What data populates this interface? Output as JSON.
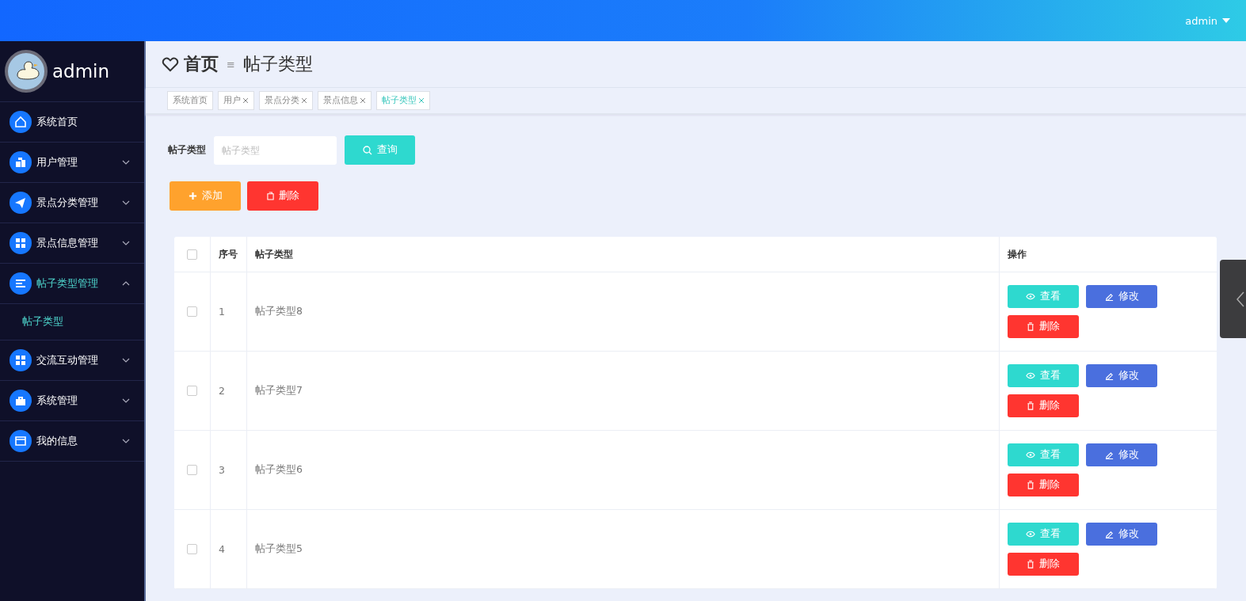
{
  "top_bar": {
    "user": "admin"
  },
  "sidebar": {
    "user_name": "admin",
    "items": [
      {
        "label": "系统首页",
        "selected": false
      },
      {
        "label": "用户管理",
        "selected": false,
        "expanded": false
      },
      {
        "label": "景点分类管理",
        "selected": false,
        "expanded": false
      },
      {
        "label": "景点信息管理",
        "selected": false,
        "expanded": false
      },
      {
        "label": "帖子类型管理",
        "selected": true,
        "expanded": true,
        "children": [
          {
            "label": "帖子类型",
            "selected": true
          }
        ]
      },
      {
        "label": "交流互动管理",
        "selected": false,
        "expanded": false
      },
      {
        "label": "系统管理",
        "selected": false,
        "expanded": false
      },
      {
        "label": "我的信息",
        "selected": false,
        "expanded": false
      }
    ]
  },
  "breadcrumb": {
    "home": "首页",
    "separator": "≡",
    "current": "帖子类型"
  },
  "tags": [
    {
      "label": "系统首页",
      "closable": false,
      "selected": false
    },
    {
      "label": "用户",
      "closable": true,
      "selected": false
    },
    {
      "label": "景点分类",
      "closable": true,
      "selected": false
    },
    {
      "label": "景点信息",
      "closable": true,
      "selected": false
    },
    {
      "label": "帖子类型",
      "closable": true,
      "selected": true
    }
  ],
  "search": {
    "label": "帖子类型",
    "placeholder": "帖子类型",
    "button": "查询"
  },
  "actions": {
    "add": "添加",
    "delete": "删除"
  },
  "table": {
    "columns": [
      "序号",
      "帖子类型",
      "操作"
    ],
    "all_checked": false,
    "rows": [
      {
        "index": "1",
        "name": "帖子类型8",
        "checked": false,
        "buttons": {
          "view": "查看",
          "edit": "修改",
          "delete": "删除"
        }
      },
      {
        "index": "2",
        "name": "帖子类型7",
        "checked": false,
        "buttons": {
          "view": "查看",
          "edit": "修改",
          "delete": "删除"
        }
      },
      {
        "index": "3",
        "name": "帖子类型6",
        "checked": false,
        "buttons": {
          "view": "查看",
          "edit": "修改",
          "delete": "删除"
        }
      },
      {
        "index": "4",
        "name": "帖子类型5",
        "checked": false,
        "buttons": {
          "view": "查看",
          "edit": "修改",
          "delete": "删除"
        }
      }
    ]
  }
}
